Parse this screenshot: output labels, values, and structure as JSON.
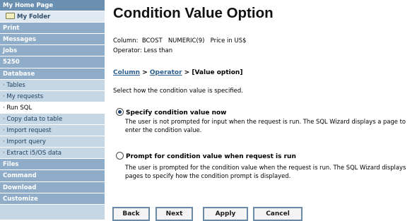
{
  "sidebar": {
    "items": [
      {
        "label": "My Home Page",
        "kind": "top"
      },
      {
        "label": "My Folder",
        "kind": "folder"
      },
      {
        "label": "Print",
        "kind": "section"
      },
      {
        "label": "Messages",
        "kind": "section"
      },
      {
        "label": "Jobs",
        "kind": "section"
      },
      {
        "label": "5250",
        "kind": "section"
      },
      {
        "label": "Database",
        "kind": "section"
      },
      {
        "label": "· Tables",
        "kind": "sub"
      },
      {
        "label": "· My requests",
        "kind": "sub"
      },
      {
        "label": "· Run SQL",
        "kind": "sub",
        "active": true
      },
      {
        "label": "· Copy data to table",
        "kind": "sub"
      },
      {
        "label": "· Import request",
        "kind": "sub"
      },
      {
        "label": "· Import query",
        "kind": "sub"
      },
      {
        "label": "· Extract i5/OS data",
        "kind": "sub"
      },
      {
        "label": "Files",
        "kind": "section"
      },
      {
        "label": "Command",
        "kind": "section"
      },
      {
        "label": "Download",
        "kind": "section"
      },
      {
        "label": "Customize",
        "kind": "section"
      }
    ]
  },
  "main": {
    "title": "Condition Value Option",
    "column_line": "Column:  BCOST   NUMERIC(9)   Price in US$",
    "operator_line": "Operator: Less than",
    "breadcrumb": {
      "link1": "Column",
      "sep1": " > ",
      "link2": "Operator",
      "sep2": " > ",
      "current": "[Value option]"
    },
    "instruction": "Select how the condition value is specified.",
    "options": [
      {
        "label": "Specify condition value now",
        "checked": true,
        "description": "The user is not prompted for input when the request is run. The SQL Wizard displays a page to enter the condition value."
      },
      {
        "label": "Prompt for condition value when request is run",
        "checked": false,
        "description": "The user is prompted for the condition value when the request is run. The SQL Wizard displays pages to specify how the condition prompt is displayed."
      }
    ]
  },
  "buttons": {
    "back": "Back",
    "next": "Next",
    "apply": "Apply",
    "cancel": "Cancel"
  },
  "colors": {
    "sidebar_bg": "#c5d6e4",
    "sidebar_header": "#6b8fb0",
    "sidebar_section": "#8fadc8",
    "link": "#2c5e8f",
    "button_border": "#6a8aa8"
  }
}
